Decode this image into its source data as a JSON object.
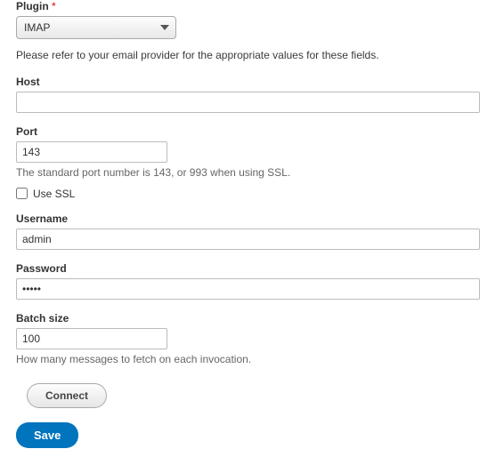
{
  "plugin": {
    "label": "Plugin",
    "required_marker": "*",
    "value": "IMAP",
    "hint": "Please refer to your email provider for the appropriate values for these fields."
  },
  "host": {
    "label": "Host",
    "value": ""
  },
  "port": {
    "label": "Port",
    "value": "143",
    "desc": "The standard port number is 143, or 993 when using SSL."
  },
  "ssl": {
    "label": "Use SSL",
    "checked": false
  },
  "username": {
    "label": "Username",
    "value": "admin"
  },
  "password": {
    "label": "Password",
    "value": "•••••"
  },
  "batch": {
    "label": "Batch size",
    "value": "100",
    "desc": "How many messages to fetch on each invocation."
  },
  "buttons": {
    "connect": "Connect",
    "save": "Save"
  }
}
